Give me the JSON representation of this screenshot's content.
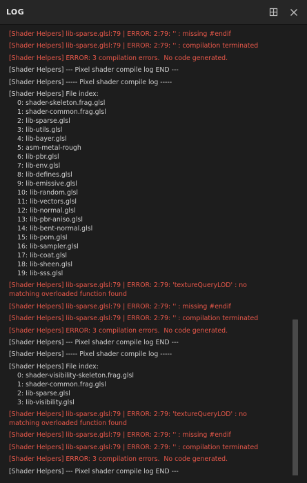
{
  "window": {
    "title": "LOG",
    "float_icon": "panel-float-icon",
    "close_icon": "close-icon"
  },
  "colors": {
    "error": "#e8584a",
    "info": "#cfcfcf",
    "background": "#1d1d1d",
    "titlebar": "#262626"
  },
  "log": {
    "lines": [
      {
        "type": "error",
        "text": "[Shader Helpers] lib-sparse.glsl:79 | ERROR: 2:79: '' : missing #endif"
      },
      {
        "type": "error",
        "text": "[Shader Helpers] lib-sparse.glsl:79 | ERROR: 2:79: '' : compilation terminated"
      },
      {
        "type": "error",
        "text": "[Shader Helpers] ERROR: 3 compilation errors.  No code generated."
      },
      {
        "type": "info",
        "text": "[Shader Helpers] --- Pixel shader compile log END ---"
      },
      {
        "type": "info",
        "text": "[Shader Helpers] ----- Pixel shader compile log -----"
      },
      {
        "type": "info",
        "text": "[Shader Helpers] File index:"
      },
      {
        "type": "idx",
        "text": "0: shader-skeleton.frag.glsl"
      },
      {
        "type": "idx",
        "text": "1: shader-common.frag.glsl"
      },
      {
        "type": "idx",
        "text": "2: lib-sparse.glsl"
      },
      {
        "type": "idx",
        "text": "3: lib-utils.glsl"
      },
      {
        "type": "idx",
        "text": "4: lib-bayer.glsl"
      },
      {
        "type": "idx",
        "text": "5: asm-metal-rough"
      },
      {
        "type": "idx",
        "text": "6: lib-pbr.glsl"
      },
      {
        "type": "idx",
        "text": "7: lib-env.glsl"
      },
      {
        "type": "idx",
        "text": "8: lib-defines.glsl"
      },
      {
        "type": "idx",
        "text": "9: lib-emissive.glsl"
      },
      {
        "type": "idx",
        "text": "10: lib-random.glsl"
      },
      {
        "type": "idx",
        "text": "11: lib-vectors.glsl"
      },
      {
        "type": "idx",
        "text": "12: lib-normal.glsl"
      },
      {
        "type": "idx",
        "text": "13: lib-pbr-aniso.glsl"
      },
      {
        "type": "idx",
        "text": "14: lib-bent-normal.glsl"
      },
      {
        "type": "idx",
        "text": "15: lib-pom.glsl"
      },
      {
        "type": "idx",
        "text": "16: lib-sampler.glsl"
      },
      {
        "type": "idx",
        "text": "17: lib-coat.glsl"
      },
      {
        "type": "idx",
        "text": "18: lib-sheen.glsl"
      },
      {
        "type": "idx",
        "text": "19: lib-sss.glsl"
      },
      {
        "type": "error",
        "text": "[Shader Helpers] lib-sparse.glsl:79 | ERROR: 2:79: 'textureQueryLOD' : no matching overloaded function found"
      },
      {
        "type": "error",
        "text": "[Shader Helpers] lib-sparse.glsl:79 | ERROR: 2:79: '' : missing #endif"
      },
      {
        "type": "error",
        "text": "[Shader Helpers] lib-sparse.glsl:79 | ERROR: 2:79: '' : compilation terminated"
      },
      {
        "type": "error",
        "text": "[Shader Helpers] ERROR: 3 compilation errors.  No code generated."
      },
      {
        "type": "info",
        "text": "[Shader Helpers] --- Pixel shader compile log END ---"
      },
      {
        "type": "info",
        "text": "[Shader Helpers] ----- Pixel shader compile log -----"
      },
      {
        "type": "info",
        "text": "[Shader Helpers] File index:"
      },
      {
        "type": "idx",
        "text": "0: shader-visibility-skeleton.frag.glsl"
      },
      {
        "type": "idx",
        "text": "1: shader-common.frag.glsl"
      },
      {
        "type": "idx",
        "text": "2: lib-sparse.glsl"
      },
      {
        "type": "idx",
        "text": "3: lib-visibility.glsl"
      },
      {
        "type": "error",
        "text": "[Shader Helpers] lib-sparse.glsl:79 | ERROR: 2:79: 'textureQueryLOD' : no matching overloaded function found"
      },
      {
        "type": "error",
        "text": "[Shader Helpers] lib-sparse.glsl:79 | ERROR: 2:79: '' : missing #endif"
      },
      {
        "type": "error",
        "text": "[Shader Helpers] lib-sparse.glsl:79 | ERROR: 2:79: '' : compilation terminated"
      },
      {
        "type": "error",
        "text": "[Shader Helpers] ERROR: 3 compilation errors.  No code generated."
      },
      {
        "type": "info",
        "text": "[Shader Helpers] --- Pixel shader compile log END ---"
      }
    ]
  }
}
